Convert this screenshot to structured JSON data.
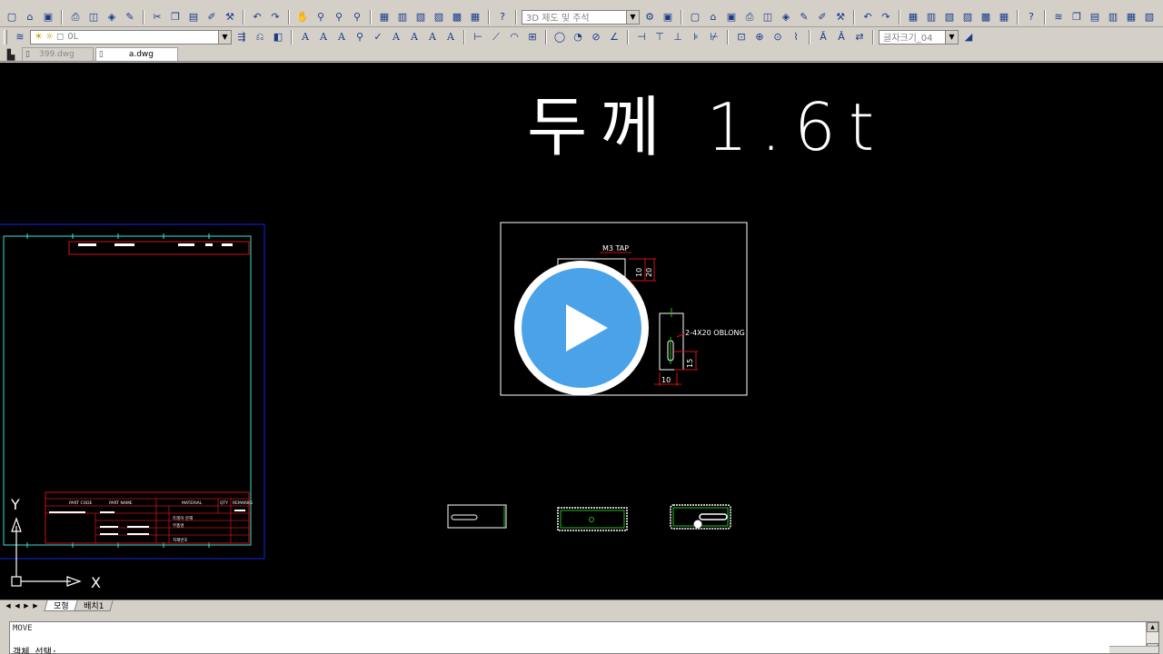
{
  "toolbar": {
    "workspace_combo": "3D 제도 및 주석",
    "layer_combo": "0L",
    "text_style_combo": "글자크기_04"
  },
  "document_tabs": [
    {
      "label": "399.dwg",
      "active": false
    },
    {
      "label": "a.dwg",
      "active": true
    }
  ],
  "drawing": {
    "title_text": "두께 1.6t",
    "annotation_tap": "M3 TAP",
    "annotation_oblong": "2-4X20 OBLONG",
    "dim_10_a": "10",
    "dim_20": "20",
    "dim_15": "15",
    "dim_10_b": "10",
    "titleblock_texts": [
      "PART CODE",
      "PART NAME",
      "MATERIAL",
      "QTY",
      "REMARKS",
      "트레이 분해",
      "부품명",
      "자재번호"
    ],
    "ucs_x": "X",
    "ucs_y": "Y"
  },
  "layout_tabs": [
    {
      "label": "모형",
      "active": true
    },
    {
      "label": "배치1",
      "active": false
    }
  ],
  "command": {
    "line1": "MOVE",
    "line2": "객체 선택:"
  },
  "colors": {
    "canvas_bg": "#000000",
    "play_button": "#4aa3e8",
    "dimension_red": "#d01010",
    "outline_white": "#ffffff",
    "frame_blue": "#1020c0",
    "frame_cyan": "#40e0d0",
    "green": "#20c020"
  },
  "icons": {
    "play_overlay": "play-icon"
  }
}
